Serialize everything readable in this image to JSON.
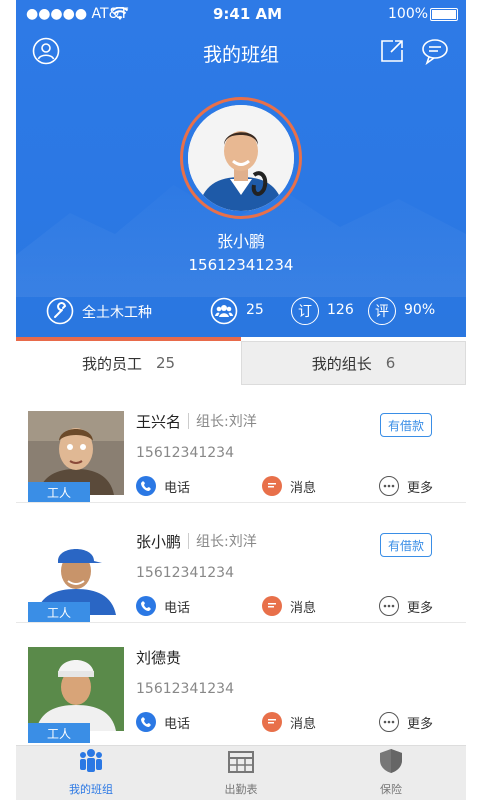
{
  "status_bar": {
    "carrier": "●●●●● AT&T",
    "time": "9:41 AM",
    "battery": "100%"
  },
  "header": {
    "title": "我的班组"
  },
  "profile": {
    "name": "张小鹏",
    "phone": "15612341234"
  },
  "stats": {
    "trade": "全土木工种",
    "members": "25",
    "orders_icon_char": "订",
    "orders": "126",
    "rating_icon_char": "评",
    "rating": "90%"
  },
  "tabs": [
    {
      "label": "我的员工",
      "count": "25"
    },
    {
      "label": "我的组长",
      "count": "6"
    }
  ],
  "employees": [
    {
      "name": "王兴名",
      "leader": "组长:刘洋",
      "phone": "15612341234",
      "badge": "有借款",
      "role": "工人"
    },
    {
      "name": "张小鹏",
      "leader": "组长:刘洋",
      "phone": "15612341234",
      "badge": "有借款",
      "role": "工人"
    },
    {
      "name": "刘德贵",
      "leader": "",
      "phone": "15612341234",
      "badge": "",
      "role": "工人"
    }
  ],
  "actions": {
    "call": "电话",
    "message": "消息",
    "more": "更多"
  },
  "tabbar": [
    {
      "label": "我的班组",
      "icon": "team-icon"
    },
    {
      "label": "出勤表",
      "icon": "calendar-icon"
    },
    {
      "label": "保险",
      "icon": "shield-icon"
    }
  ],
  "colors": {
    "primary": "#2b78e4",
    "accent": "#e86a4a",
    "link": "#3a8ee6"
  }
}
